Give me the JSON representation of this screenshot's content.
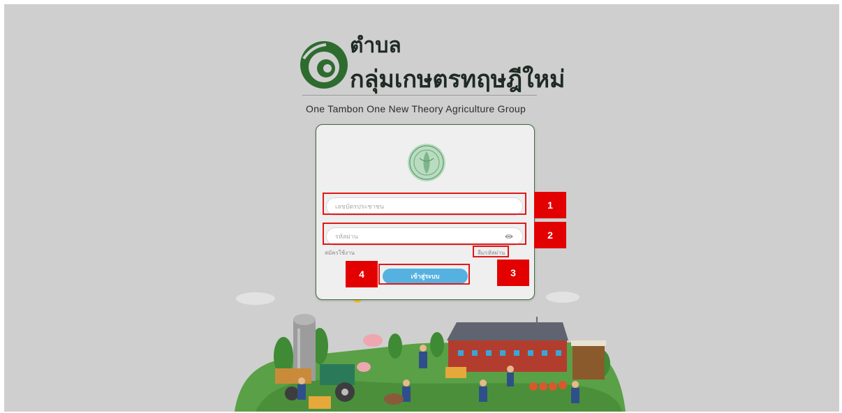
{
  "brand": {
    "line1": "ตำบล",
    "line2": "กลุ่มเกษตรทฤษฎีใหม่",
    "tagline": "One Tambon One  New Theory Agriculture Group"
  },
  "login": {
    "id_placeholder": "เลขบัตรประชาชน",
    "password_placeholder": "รหัสผ่าน",
    "register_label": "สมัครใช้งาน",
    "forgot_label": "ลืมรหัสผ่าน",
    "submit_label": "เข้าสู่ระบบ"
  },
  "annotations": {
    "badge1": "1",
    "badge2": "2",
    "badge3": "3",
    "badge4": "4",
    "color": "#e30000"
  },
  "icons": [
    "logo-mark-icon",
    "government-seal-icon",
    "eye-icon"
  ],
  "colors": {
    "accent": "#55b1e0",
    "brand_green": "#2e6b2f",
    "card_border": "#3d6d3a"
  }
}
